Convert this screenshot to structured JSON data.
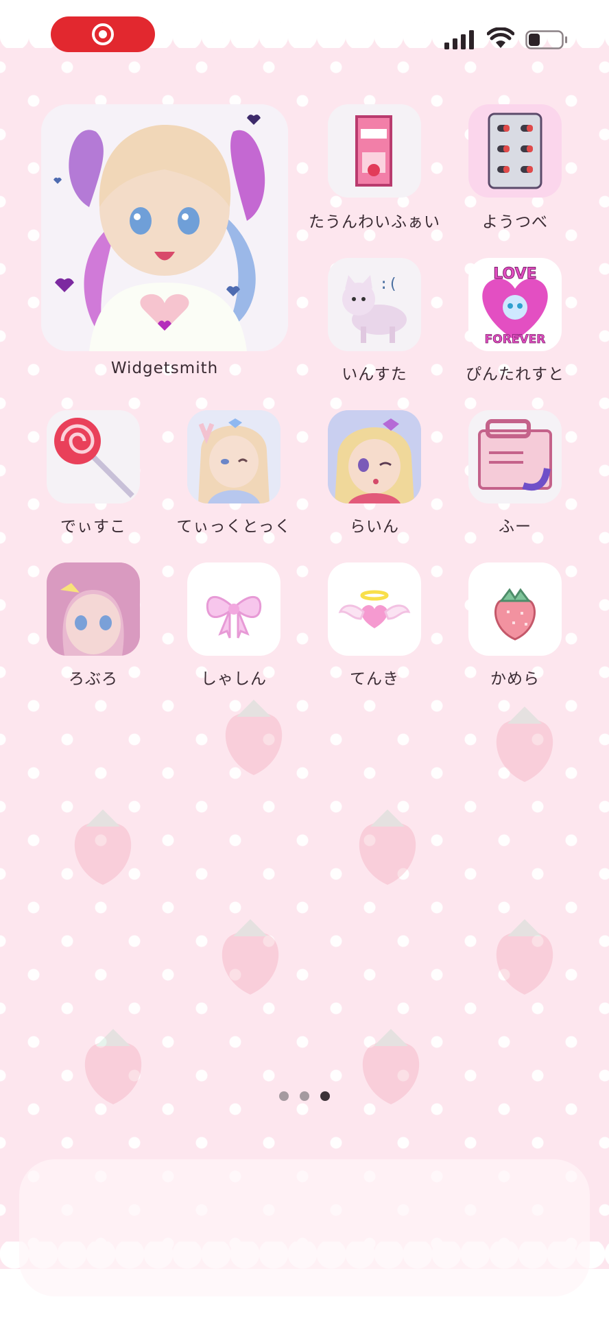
{
  "status_bar": {
    "record_indicator": "screen-recording-icon",
    "signal": "cellular-signal-icon",
    "wifi": "wifi-icon",
    "battery_level": 0.35
  },
  "widget": {
    "label": "Widgetsmith",
    "icon": "anime-girl-heart-hands"
  },
  "apps": [
    {
      "id": "tatunwaifai",
      "label": "たうんわいふぁい",
      "icon": "pocky-box-icon"
    },
    {
      "id": "youtsube",
      "label": "ようつべ",
      "icon": "pill-pack-icon"
    },
    {
      "id": "insta",
      "label": "いんすた",
      "icon": "sad-cat-icon"
    },
    {
      "id": "pintarest",
      "label": "ぴんたれすと",
      "icon": "love-forever-cat-icon"
    },
    {
      "id": "disco",
      "label": "でぃすこ",
      "icon": "lollipop-icon"
    },
    {
      "id": "tiktok",
      "label": "てぃっくとっく",
      "icon": "anime-girl-peace-icon"
    },
    {
      "id": "line",
      "label": "らいん",
      "icon": "anime-girl-wink-icon"
    },
    {
      "id": "fu",
      "label": "ふー",
      "icon": "folder-letter-icon"
    },
    {
      "id": "roburo",
      "label": "ろぶろ",
      "icon": "anime-girl-closeup-icon"
    },
    {
      "id": "shashin",
      "label": "しゃしん",
      "icon": "ribbon-bow-icon"
    },
    {
      "id": "tenki",
      "label": "てんき",
      "icon": "winged-heart-icon"
    },
    {
      "id": "kamera",
      "label": "かめら",
      "icon": "strawberry-icon"
    }
  ],
  "page_dots": {
    "count": 3,
    "active_index": 2
  },
  "colors": {
    "background": "#fde6ee",
    "record_pill": "#e2282f",
    "accent_pink": "#e86bb0"
  }
}
